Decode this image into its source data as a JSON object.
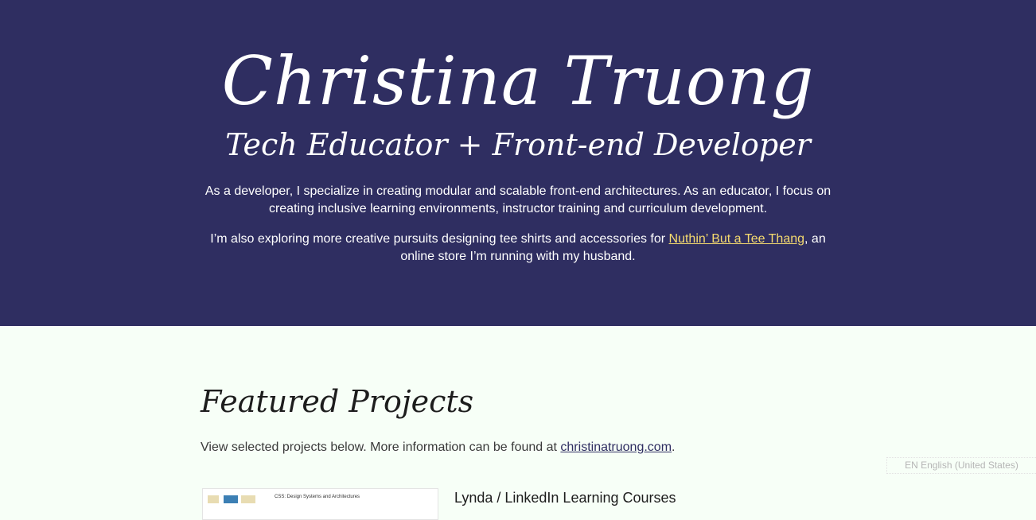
{
  "hero": {
    "name": "Christina Truong",
    "tagline": "Tech Educator + Front-end Developer",
    "paragraph1": "As a developer, I specialize in creating modular and scalable front-end architectures. As an educator, I focus on creating inclusive learning environments, instructor training and curriculum development.",
    "paragraph2_before": "I’m also exploring more creative pursuits designing tee shirts and accessories for ",
    "paragraph2_link": "Nuthin’ But a Tee Thang",
    "paragraph2_after": ", an online store I’m running with my husband.",
    "background_color": "#2f2e61",
    "link_color": "#f7dc6f"
  },
  "projects": {
    "title": "Featured Projects",
    "intro_before": "View selected projects below. More information can be found at ",
    "intro_link": "christinatruong.com",
    "intro_after": ".",
    "items": [
      {
        "thumb_caption": "CSS: Design Systems and Architectures",
        "title": "Lynda / LinkedIn Learning Courses"
      }
    ]
  },
  "language_widget": {
    "label": "EN English (United States)"
  },
  "colors": {
    "page_background": "#f7fff7"
  }
}
